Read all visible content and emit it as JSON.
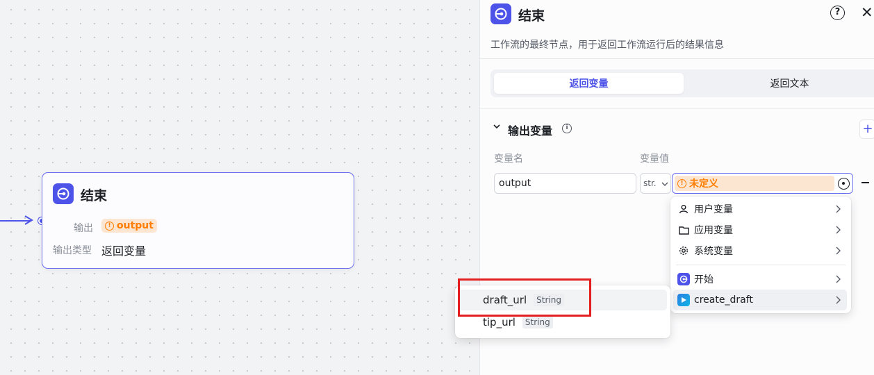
{
  "canvas": {
    "node": {
      "title": "结束",
      "output_label": "输出",
      "output_chip": "output",
      "output_type_label": "输出类型",
      "output_type_value": "返回变量"
    }
  },
  "panel": {
    "title": "结束",
    "description": "工作流的最终节点，用于返回工作流运行后的结果信息",
    "tabs": [
      {
        "label": "返回变量",
        "active": true
      },
      {
        "label": "返回文本",
        "active": false
      }
    ],
    "section_title": "输出变量",
    "columns": {
      "name": "变量名",
      "value": "变量值"
    },
    "row": {
      "name_value": "output",
      "type_value": "str.",
      "value_chip": "未定义"
    }
  },
  "variable_menu": {
    "items": [
      {
        "label": "用户变量",
        "icon": "user-icon"
      },
      {
        "label": "应用变量",
        "icon": "folder-icon"
      },
      {
        "label": "系统变量",
        "icon": "gear-icon"
      },
      {
        "label": "开始",
        "icon": "start-node-icon"
      },
      {
        "label": "create_draft",
        "icon": "plugin-node-icon"
      }
    ]
  },
  "submenu": {
    "items": [
      {
        "name": "draft_url",
        "type": "String"
      },
      {
        "name": "tip_url",
        "type": "String"
      }
    ]
  },
  "colors": {
    "accent": "#4d53e8",
    "warning": "#ff7d00",
    "warning_bg": "#fce6d2",
    "highlight_box": "#e41e1e"
  }
}
